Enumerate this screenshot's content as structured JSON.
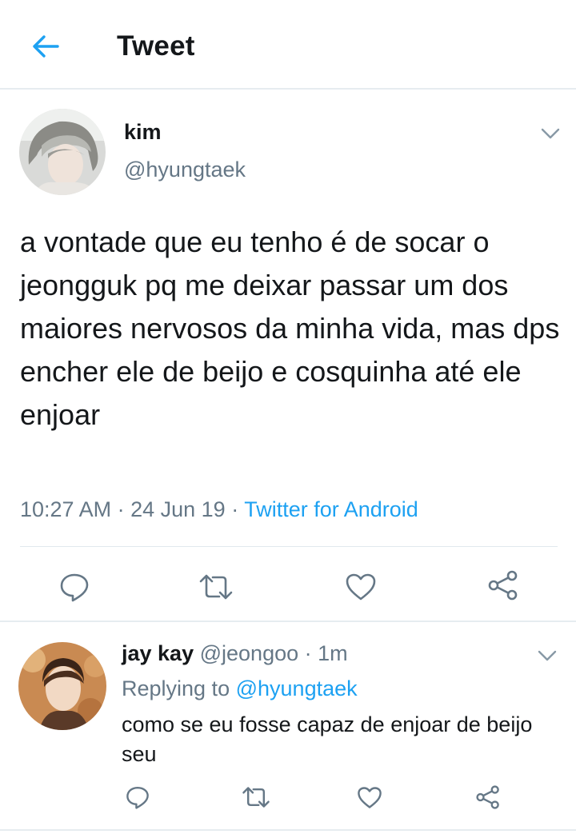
{
  "header": {
    "title": "Tweet"
  },
  "tweet": {
    "name": "kim",
    "handle": "@hyungtaek",
    "text": "a vontade que eu tenho é de socar o jeongguk pq me deixar passar um dos maiores nervosos da minha vida, mas dps encher ele de beijo e cosquinha até ele enjoar",
    "time": "10:27 AM",
    "date": "24 Jun 19",
    "separator": " · ",
    "client": "Twitter for Android"
  },
  "reply": {
    "name": "jay kay",
    "handle": "@jeongoo",
    "age": "1m",
    "separator": " · ",
    "replying_label": "Replying to",
    "replying_to": "@hyungtaek",
    "text": "como se eu fosse capaz de enjoar de beijo seu"
  },
  "colors": {
    "accent": "#1da1f2",
    "secondary_text": "#657786",
    "icon": "#657786",
    "border": "#e6ecf0"
  },
  "icons": [
    "back-arrow-icon",
    "chevron-down-icon",
    "reply-icon",
    "retweet-icon",
    "like-heart-icon",
    "share-icon"
  ]
}
